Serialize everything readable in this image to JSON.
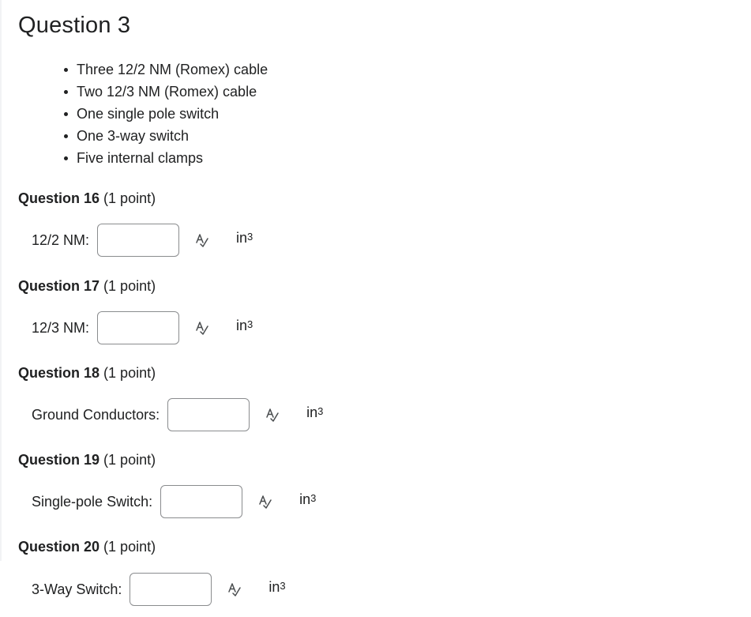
{
  "page": {
    "title": "Question 3"
  },
  "materials": [
    "Three 12/2 NM (Romex) cable",
    "Two 12/3 NM (Romex) cable",
    "One single pole switch",
    "One 3-way switch",
    "Five internal clamps"
  ],
  "questions": [
    {
      "name": "Question 16",
      "points": "(1 point)",
      "label": "12/2 NM:",
      "value": "",
      "unit": "in",
      "unit_exp": "3",
      "icon": "spellcheck-icon"
    },
    {
      "name": "Question 17",
      "points": "(1 point)",
      "label": "12/3 NM:",
      "value": "",
      "unit": "in",
      "unit_exp": "3",
      "icon": "spellcheck-icon"
    },
    {
      "name": "Question 18",
      "points": "(1 point)",
      "label": "Ground Conductors:",
      "value": "",
      "unit": "in",
      "unit_exp": "3",
      "icon": "spellcheck-icon"
    },
    {
      "name": "Question 19",
      "points": "(1 point)",
      "label": "Single-pole Switch:",
      "value": "",
      "unit": "in",
      "unit_exp": "3",
      "icon": "spellcheck-icon"
    },
    {
      "name": "Question 20",
      "points": "(1 point)",
      "label": "3-Way Switch:",
      "value": "",
      "unit": "in",
      "unit_exp": "3",
      "icon": "spellcheck-icon"
    }
  ],
  "colors": {
    "text": "#202122",
    "input_border": "#8a8c8e",
    "icon": "#494c4e"
  }
}
